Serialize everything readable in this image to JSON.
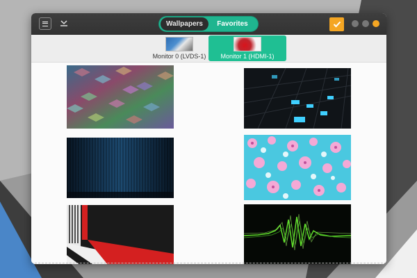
{
  "header": {
    "menu_icon": "hamburger-icon",
    "download_icon": "download-icon",
    "tabs": [
      {
        "label": "Wallpapers",
        "active": true
      },
      {
        "label": "Favorites",
        "active": false
      }
    ],
    "apply_icon": "check-icon"
  },
  "monitors": [
    {
      "label": "Monitor 0 (LVDS-1)",
      "selected": false
    },
    {
      "label": "Monitor 1 (HDMI-1)",
      "selected": true
    }
  ],
  "colors": {
    "accent": "#1fb58f",
    "selected_monitor": "#1fbf93",
    "apply": "#f5a623",
    "close": "#f5a623"
  },
  "wallpapers": [
    {
      "name": "colorful-cubes-pattern"
    },
    {
      "name": "dark-3d-tiles-cyan"
    },
    {
      "name": "blue-curtain-stripes"
    },
    {
      "name": "pink-cherry-blossoms"
    },
    {
      "name": "red-white-perspective-lines"
    },
    {
      "name": "green-sound-wave"
    }
  ]
}
